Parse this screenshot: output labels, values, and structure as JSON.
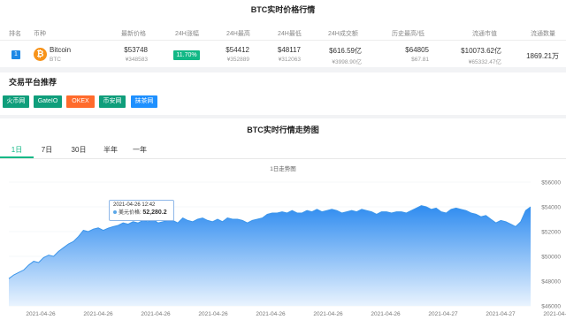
{
  "price_table": {
    "title": "BTC实时价格行情",
    "headers": {
      "rank": "排名",
      "coin": "币种",
      "price": "最新价格",
      "change": "24H涨幅",
      "high": "24H最高",
      "low": "24H最低",
      "volume": "24H成交额",
      "ath": "历史最高/低",
      "market_cap": "流通市值",
      "supply": "流通数量"
    },
    "row": {
      "rank": "1",
      "coin_icon": "bitcoin-icon",
      "coin_name": "Bitcoin",
      "coin_symbol": "BTC",
      "price": "$53748",
      "price_cny": "¥348583",
      "change": "11.70%",
      "high": "$54412",
      "high_cny": "¥352889",
      "low": "$48117",
      "low_cny": "¥312063",
      "volume": "$616.59亿",
      "volume_cny": "¥3998.90亿",
      "ath": "$64805",
      "atl": "$67.81",
      "market_cap": "$10073.62亿",
      "market_cap_cny": "¥65332.47亿",
      "supply": "1869.21万"
    }
  },
  "exchanges": {
    "title": "交易平台推荐",
    "items": [
      {
        "label": "火币网",
        "color": "#0f9e7b"
      },
      {
        "label": "GateIO",
        "color": "#0f9e7b"
      },
      {
        "label": "OKEX",
        "color": "#ff6b2c"
      },
      {
        "label": "币安网",
        "color": "#0f9e7b"
      },
      {
        "label": "抹茶网",
        "color": "#1e90ff"
      }
    ]
  },
  "trend": {
    "title": "BTC实时行情走势图",
    "tabs": [
      "1日",
      "7日",
      "30日",
      "半年",
      "一年"
    ],
    "active_tab": 0,
    "tooltip": {
      "time": "2021-04-26 12:42",
      "series_label": "美元价格:",
      "value": "52,280.2"
    }
  },
  "colors": {
    "accent": "#12b886",
    "chart_line": "#3b95ea",
    "chart_fill_top": "#2f8cf0",
    "chart_fill_bottom": "#e9f3fe"
  },
  "chart_data": {
    "type": "area",
    "title": "1日走势图",
    "ylim": [
      46000,
      56000
    ],
    "yticks": [
      "$46000",
      "$48000",
      "$50000",
      "$52000",
      "$54000",
      "$56000"
    ],
    "xticks": [
      "2021-04-26",
      "2021-04-26",
      "2021-04-26",
      "2021-04-26",
      "2021-04-26",
      "2021-04-26",
      "2021-04-26",
      "2021-04-27",
      "2021-04-27",
      "2021-04-27"
    ],
    "grid": true,
    "series": [
      {
        "values": [
          48200,
          48500,
          48700,
          48900,
          49300,
          49600,
          49500,
          49900,
          50100,
          50000,
          50400,
          50700,
          51000,
          51200,
          51600,
          52100,
          52000,
          52200,
          52300,
          52100,
          52280,
          52400,
          52500,
          52700,
          52600,
          52800,
          52700,
          52900,
          52800,
          53000,
          52700,
          52800,
          52900,
          52900,
          52700,
          53100,
          52900,
          52800,
          53000,
          53100,
          52900,
          52800,
          53000,
          52800,
          53100,
          53000,
          53000,
          52900,
          52700,
          52900,
          53000,
          53100,
          53400,
          53500,
          53500,
          53600,
          53500,
          53700,
          53500,
          53500,
          53700,
          53600,
          53800,
          53600,
          53700,
          53800,
          53700,
          53500,
          53600,
          53700,
          53600,
          53800,
          53700,
          53600,
          53400,
          53600,
          53600,
          53500,
          53600,
          53600,
          53500,
          53700,
          53900,
          54100,
          54000,
          53800,
          53900,
          53600,
          53500,
          53800,
          53900,
          53800,
          53700,
          53500,
          53400,
          53200,
          53300,
          53000,
          52700,
          52900,
          52800,
          52600,
          52400,
          52800,
          53700,
          54000
        ]
      }
    ]
  }
}
